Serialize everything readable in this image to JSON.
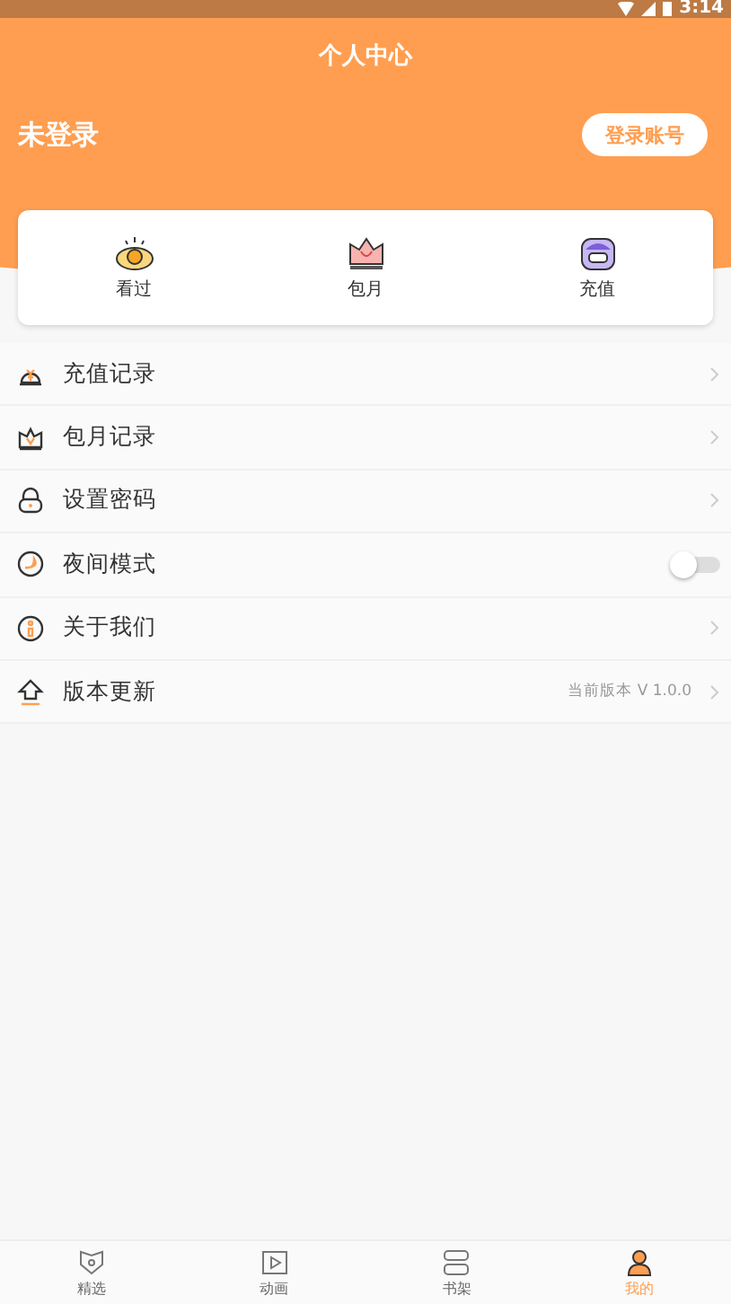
{
  "status_bar": {
    "time": "3:14"
  },
  "header": {
    "title": "个人中心",
    "user_name": "未登录",
    "login_button": "登录账号"
  },
  "shortcuts": [
    {
      "label": "看过"
    },
    {
      "label": "包月"
    },
    {
      "label": "充值"
    }
  ],
  "menu": [
    {
      "kind": "link",
      "label": "充值记录"
    },
    {
      "kind": "link",
      "label": "包月记录"
    },
    {
      "kind": "link",
      "label": "设置密码"
    },
    {
      "kind": "toggle",
      "label": "夜间模式",
      "on": false
    },
    {
      "kind": "link",
      "label": "关于我们"
    },
    {
      "kind": "link",
      "label": "版本更新",
      "note": "当前版本 V 1.0.0"
    }
  ],
  "tabs": [
    {
      "label": "精选",
      "selected": false
    },
    {
      "label": "动画",
      "selected": false
    },
    {
      "label": "书架",
      "selected": false
    },
    {
      "label": "我的",
      "selected": true
    }
  ]
}
